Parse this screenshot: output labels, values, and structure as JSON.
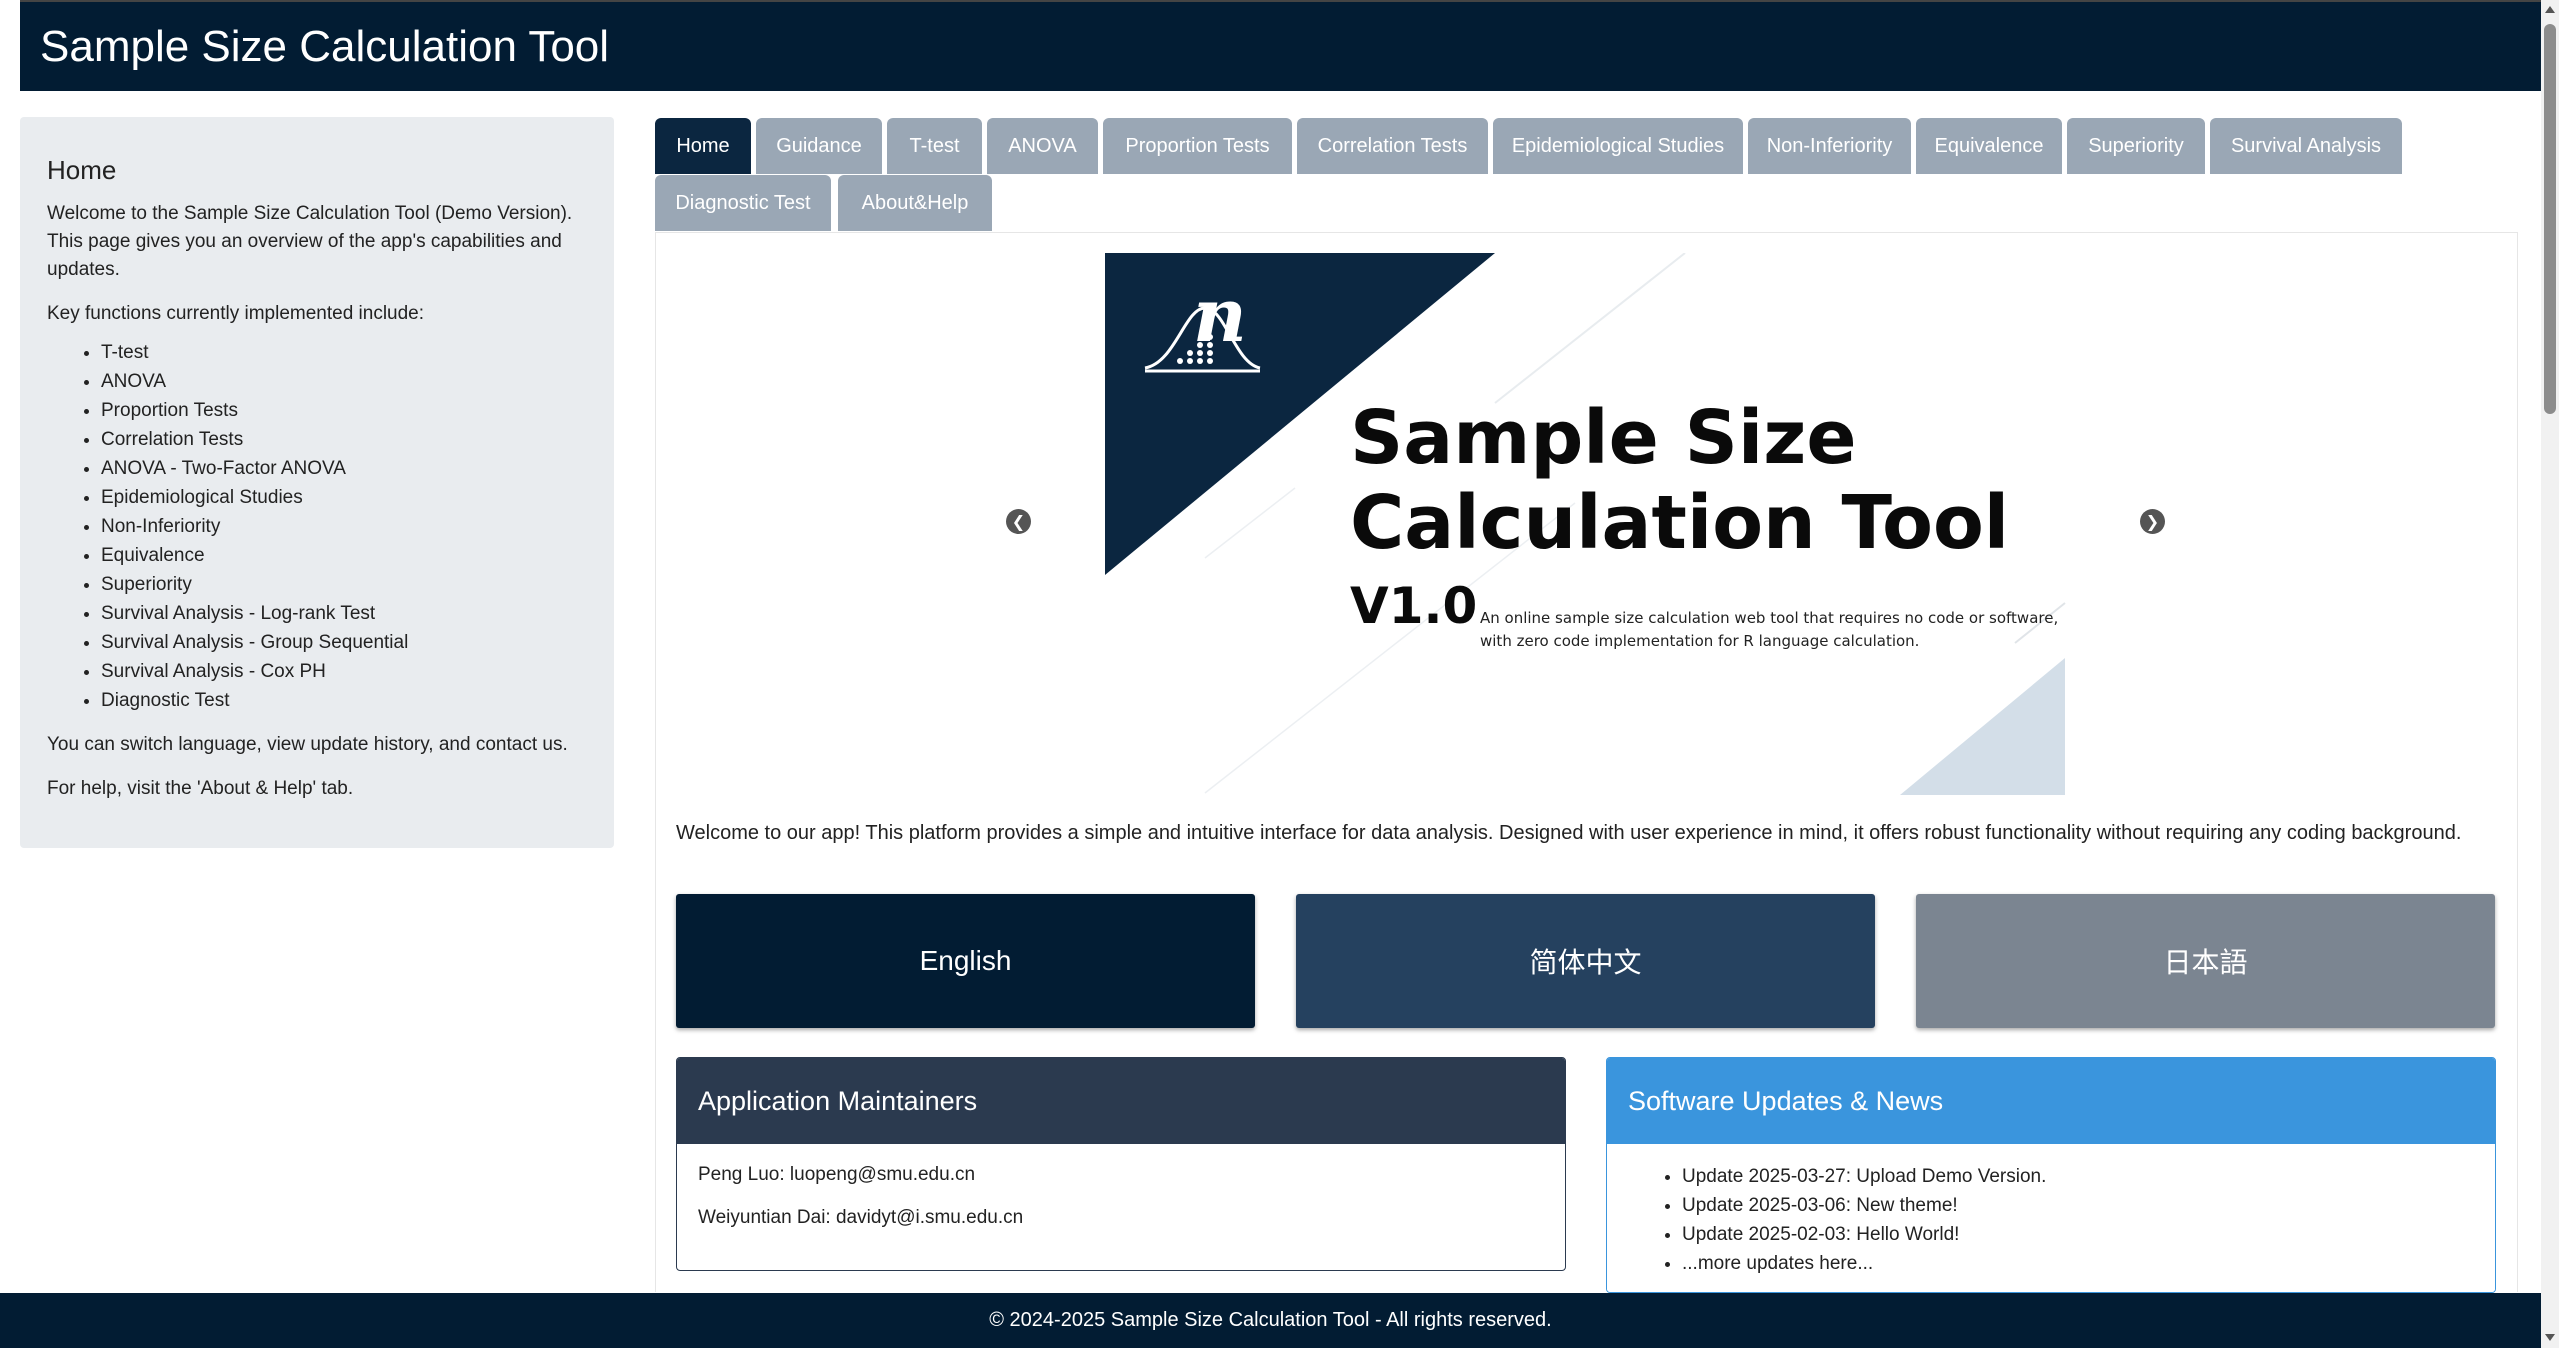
{
  "header": {
    "title": "Sample Size Calculation Tool"
  },
  "sidebar": {
    "heading": "Home",
    "intro": "Welcome to the Sample Size Calculation Tool (Demo Version). This page gives you an overview of the app's capabilities and updates.",
    "functions_label": "Key functions currently implemented include:",
    "functions": [
      "T-test",
      "ANOVA",
      "Proportion Tests",
      "Correlation Tests",
      "ANOVA - Two-Factor ANOVA",
      "Epidemiological Studies",
      "Non-Inferiority",
      "Equivalence",
      "Superiority",
      "Survival Analysis - Log-rank Test",
      "Survival Analysis - Group Sequential",
      "Survival Analysis - Cox PH",
      "Diagnostic Test"
    ],
    "switch_text": "You can switch language, view update history, and contact us.",
    "help_text": "For help, visit the 'About & Help' tab."
  },
  "tabs": [
    {
      "label": "Home",
      "active": true
    },
    {
      "label": "Guidance"
    },
    {
      "label": "T-test"
    },
    {
      "label": "ANOVA"
    },
    {
      "label": "Proportion Tests"
    },
    {
      "label": "Correlation Tests"
    },
    {
      "label": "Epidemiological Studies"
    },
    {
      "label": "Non-Inferiority"
    },
    {
      "label": "Equivalence"
    },
    {
      "label": "Superiority"
    },
    {
      "label": "Survival Analysis"
    },
    {
      "label": "Diagnostic Test"
    },
    {
      "label": "About&Help"
    }
  ],
  "banner": {
    "logo_letter": "n",
    "title_line1": "Sample Size",
    "title_line2": "Calculation Tool",
    "version": "V1.0",
    "desc_line1": "An online sample size calculation web tool that requires no code or software,",
    "desc_line2": "with zero code implementation for R language calculation."
  },
  "welcome_text": "Welcome to our app! This platform provides a simple and intuitive interface for data analysis. Designed with user experience in mind, it offers robust functionality without requiring any coding background.",
  "languages": [
    {
      "label": "English",
      "color": "#021c33"
    },
    {
      "label": "简体中文",
      "color": "#25415f"
    },
    {
      "label": "日本語",
      "color": "#7b8591"
    }
  ],
  "maintainers": {
    "title": "Application Maintainers",
    "header_color": "#2b3a4f",
    "people": [
      "Peng Luo: luopeng@smu.edu.cn",
      "Weiyuntian Dai: davidyt@i.smu.edu.cn"
    ]
  },
  "updates": {
    "title": "Software Updates & News",
    "header_color": "#3a95dd",
    "items": [
      "Update 2025-03-27: Upload Demo Version.",
      "Update 2025-03-06: New theme!",
      "Update 2025-02-03: Hello World!",
      "...more updates here..."
    ]
  },
  "footer": {
    "text": "© 2024-2025 Sample Size Calculation Tool - All rights reserved."
  },
  "colors": {
    "header_bg": "#021c33",
    "tab_bg": "#9aa7b5",
    "tab_active_bg": "#0b2640",
    "sidebar_bg": "#e9ecef"
  }
}
